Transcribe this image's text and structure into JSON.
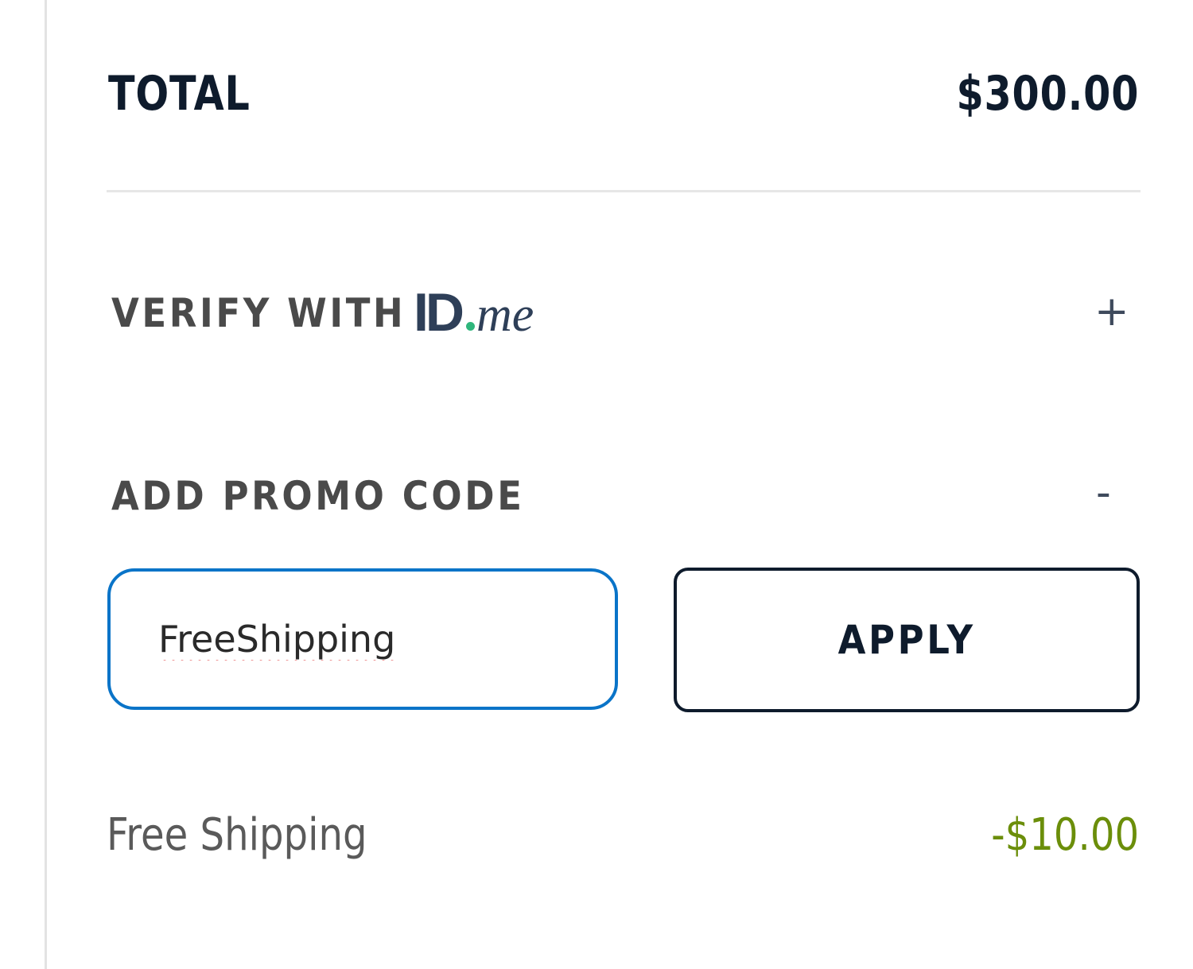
{
  "order_summary": {
    "total_label": "TOTAL",
    "total_value": "$300.00"
  },
  "verify": {
    "label": "VERIFY WITH",
    "logo_text_id": "ID",
    "logo_text_me": "me",
    "toggle_symbol": "+",
    "logo_colors": {
      "text": "#2e3f58",
      "dot": "#2fb67c"
    }
  },
  "promo": {
    "label": "ADD PROMO CODE",
    "toggle_symbol": "-",
    "input_value": "FreeShipping",
    "apply_label": "APPLY"
  },
  "discount": {
    "label": "Free Shipping",
    "value": "-$10.00",
    "value_color": "#6b8e0a"
  },
  "colors": {
    "primary_text": "#0e1b2c",
    "focus_border": "#0a74c8"
  }
}
